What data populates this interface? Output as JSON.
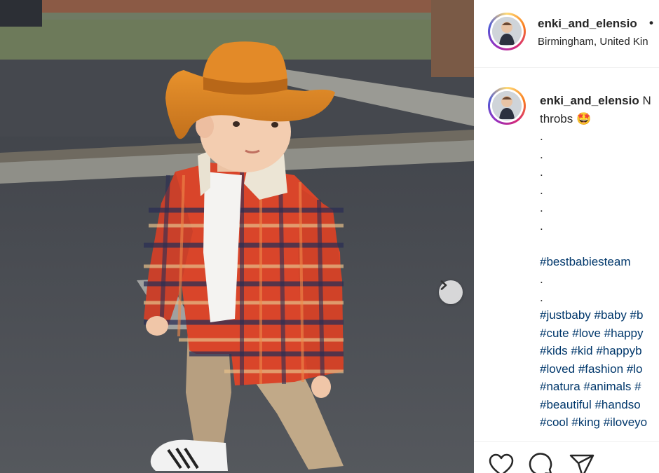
{
  "post": {
    "username": "enki_and_elensio",
    "follow_separator": "•",
    "location": "Birmingham, United Kin",
    "photo_alt": "Toddler wearing an orange cowboy hat and red plaid shirt",
    "next_label": "Next"
  },
  "caption": {
    "username": "enki_and_elensio",
    "text_start": "N",
    "line2_text": "throbs",
    "line2_emoji": "🤩",
    "dots": [
      ".",
      ".",
      ".",
      ".",
      ".",
      "."
    ],
    "hashtag_main": "#bestbabiesteam",
    "dots2": [
      ".",
      "."
    ],
    "hashtag_lines": [
      "#justbaby #baby #b",
      "#cute #love #happy",
      "#kids #kid #happyb",
      "#loved #fashion #lo",
      "#natura #animals #",
      "#beautiful #handso",
      "#cool #king #iloveyo"
    ]
  },
  "actions": {
    "like_icon": "heart-icon",
    "comment_icon": "comment-icon",
    "share_icon": "share-icon"
  },
  "colors": {
    "hashtag": "#00376b",
    "text": "#262626",
    "divider": "#efefef"
  }
}
